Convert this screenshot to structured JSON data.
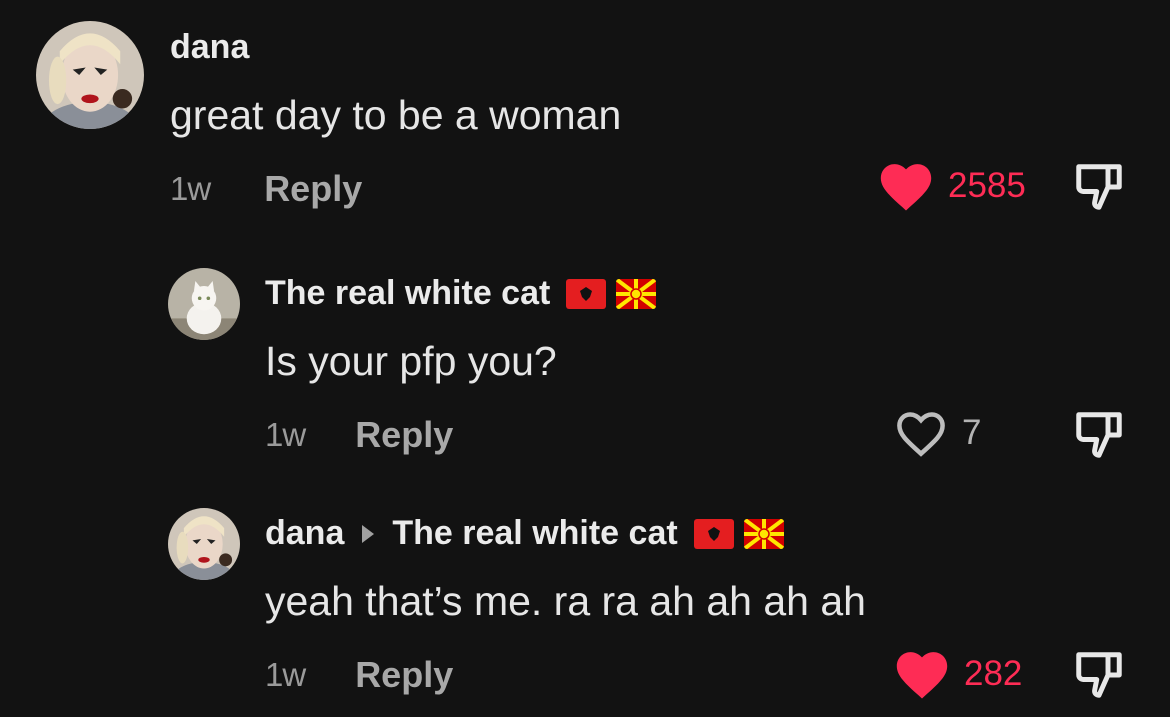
{
  "comments": [
    {
      "username": "dana",
      "text": "great day to be a woman",
      "time": "1w",
      "reply_label": "Reply",
      "likes": "2585",
      "liked": true,
      "avatar": "woman-glam-avatar"
    },
    {
      "username": "The real white cat",
      "flags": [
        "albania-flag",
        "north-macedonia-flag"
      ],
      "text": "Is your pfp you?",
      "time": "1w",
      "reply_label": "Reply",
      "likes": "7",
      "liked": false,
      "avatar": "white-cat-avatar"
    },
    {
      "username": "dana",
      "reply_to": "The real white cat",
      "flags": [
        "albania-flag",
        "north-macedonia-flag"
      ],
      "text": "yeah that’s me. ra ra ah ah ah ah",
      "time": "1w",
      "reply_label": "Reply",
      "likes": "282",
      "liked": true,
      "avatar": "woman-glam-avatar"
    }
  ],
  "colors": {
    "background": "#121212",
    "like_active": "#fe2c55"
  }
}
